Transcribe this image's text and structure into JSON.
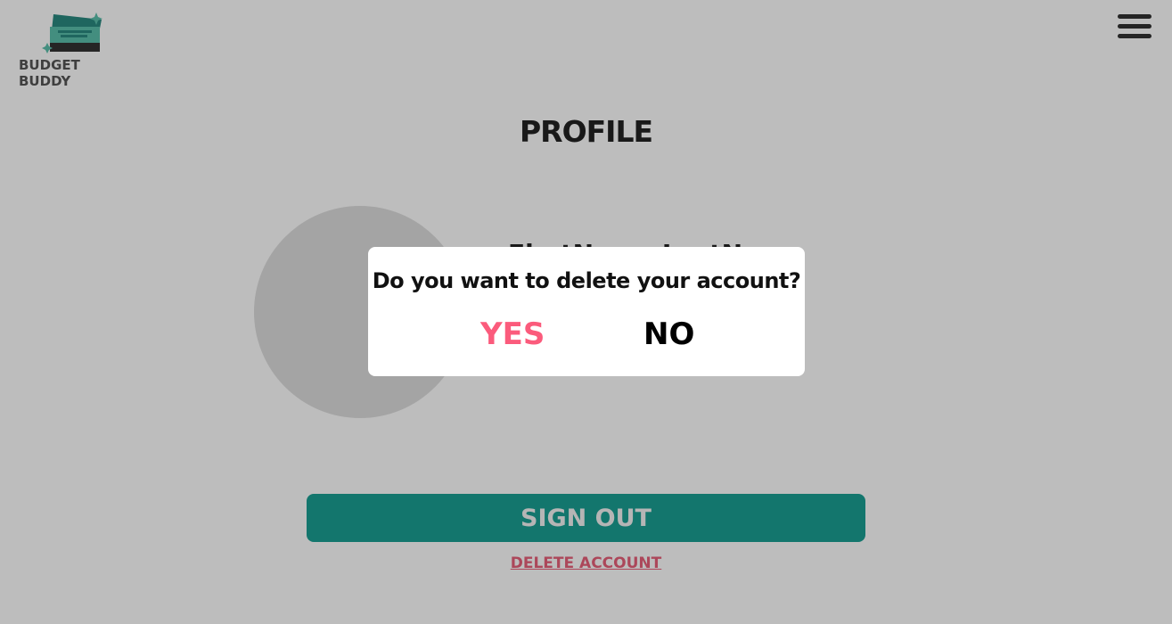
{
  "header": {
    "logo_text": "BUDGET BUDDY",
    "menu_icon": "hamburger-icon"
  },
  "profile": {
    "title": "PROFILE",
    "name": "FirstName LastName",
    "sign_out_label": "SIGN OUT",
    "delete_account_label": "DELETE ACCOUNT"
  },
  "dialog": {
    "question": "Do you want to delete your account?",
    "yes_label": "YES",
    "no_label": "NO"
  },
  "colors": {
    "accent": "#1aa093",
    "danger": "#fb5b7c"
  }
}
